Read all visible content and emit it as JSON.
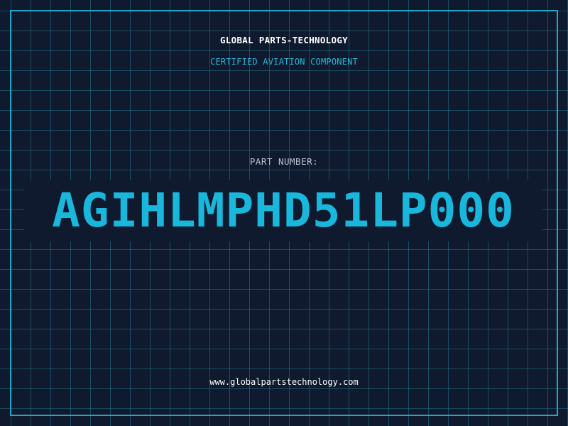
{
  "header": {
    "company": "GLOBAL PARTS-TECHNOLOGY",
    "subtitle": "CERTIFIED AVIATION COMPONENT"
  },
  "part": {
    "label": "PART NUMBER:",
    "number": "AGIHLMPHD51LP000"
  },
  "footer": {
    "website": "www.globalpartstechnology.com"
  },
  "colors": {
    "background": "#0f1a2e",
    "grid": "#288ca0",
    "frame": "#1fa7c9",
    "accent": "#19b7dc",
    "label": "#b7c3d0",
    "title": "#ffffff"
  }
}
